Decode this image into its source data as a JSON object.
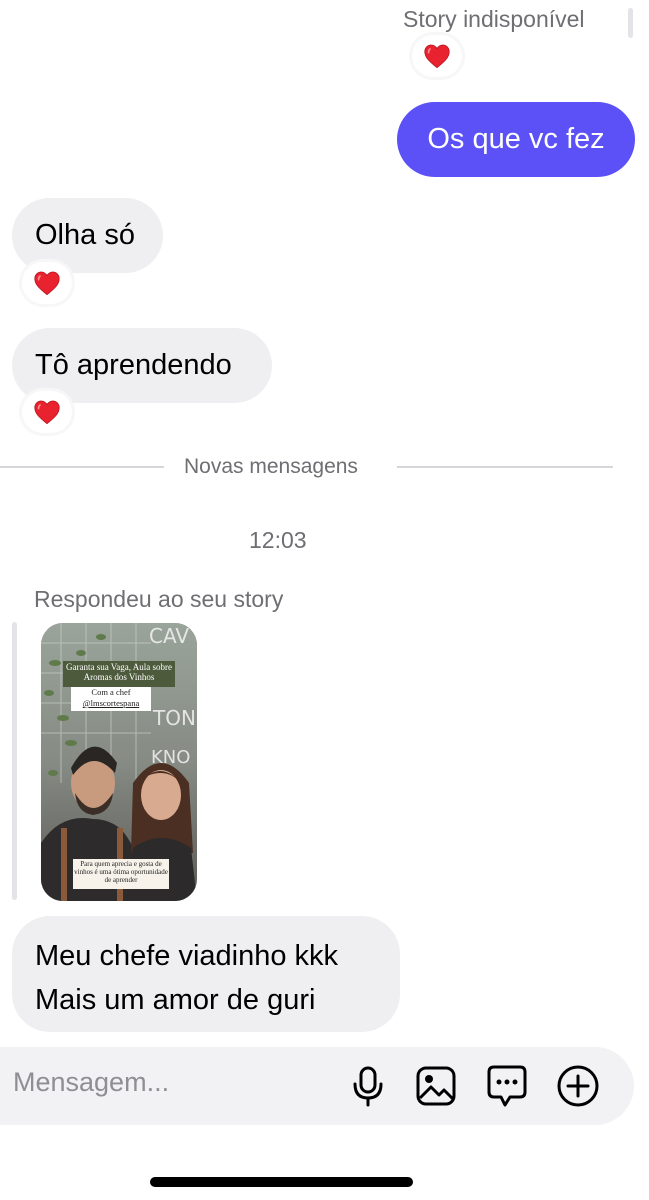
{
  "thread": {
    "story_unavailable_label": "Story indisponível",
    "outgoing_message": "Os que vc fez",
    "incoming_1": "Olha só",
    "incoming_2": "Tô aprendendo",
    "reaction_emoji": "heart",
    "new_messages_label": "Novas mensagens",
    "time_label": "12:03",
    "reply_label": "Respondeu ao seu story",
    "story_card": {
      "top_caption": "Garanta sua Vaga, Aula sobre Aromas dos Vinhos",
      "chef_line": "Com a chef",
      "chef_handle": "@lmscortespana",
      "bottom_caption": "Para quem aprecia e gosta de vinhos é uma ótima oportunidade de aprender"
    },
    "last_message_line_1": "Meu chefe viadinho kkk",
    "last_message_line_2": "Mais um amor de guri"
  },
  "composer": {
    "placeholder": "Mensagem...",
    "icons": [
      "microphone-icon",
      "image-icon",
      "chat-bubble-icon",
      "plus-circle-icon"
    ]
  },
  "colors": {
    "outgoing_bubble": "#5b51f6",
    "incoming_bubble": "#efeff2",
    "secondary_text": "#6e6e73",
    "heart": "#e8222e"
  }
}
